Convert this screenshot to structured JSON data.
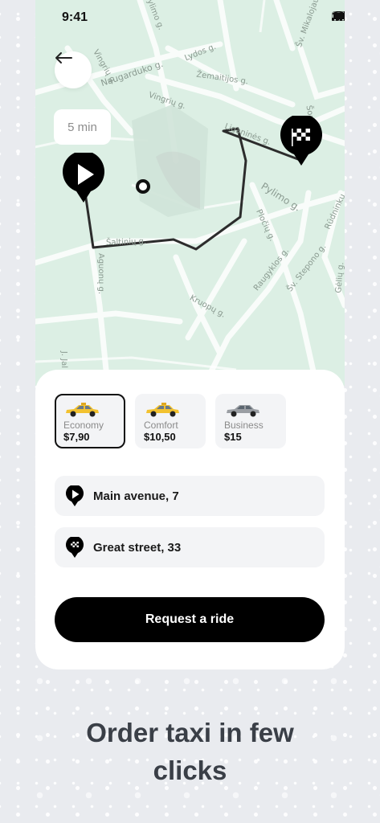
{
  "status_bar": {
    "time": "9:41",
    "icons": [
      "signal-icon",
      "wifi-icon",
      "battery-icon"
    ]
  },
  "map": {
    "back_icon": "arrow-left-icon",
    "eta": "5 min",
    "start_pin_icon": "play-icon",
    "end_pin_icon": "checkered-flag-icon",
    "street_labels": [
      "Pylimo g.",
      "Lydos g.",
      "Naugarduko g.",
      "Vingrių g.",
      "Žemaitijos g.",
      "Vingrių g.",
      "Liganinės g.",
      "Pylimo g.",
      "Šaltinių g.",
      "Pločių g.",
      "Raugyklos g.",
      "Šv. Stepono g.",
      "Kruopų g.",
      "Aguonų g.",
      "Rūdninkų",
      "Gėlių g.",
      "J. Jal",
      "Šv. Mikalojaus",
      "Šop"
    ]
  },
  "ride_options": [
    {
      "name": "Economy",
      "price": "$7,90",
      "selected": true,
      "car_color": "#f2c230"
    },
    {
      "name": "Comfort",
      "price": "$10,50",
      "selected": false,
      "car_color": "#f2c230"
    },
    {
      "name": "Business",
      "price": "$15",
      "selected": false,
      "car_color": "#9a9ea3"
    }
  ],
  "route": {
    "from": {
      "icon": "play-pin-icon",
      "text": "Main avenue, 7"
    },
    "to": {
      "icon": "flag-pin-icon",
      "text": "Great street, 33"
    }
  },
  "request_button": "Request a ride",
  "headline": {
    "line1": "Order taxi in few",
    "line2": "clicks"
  },
  "colors": {
    "map_bg": "#dcefe4",
    "accent": "#000000",
    "headline": "#3a3f47"
  }
}
